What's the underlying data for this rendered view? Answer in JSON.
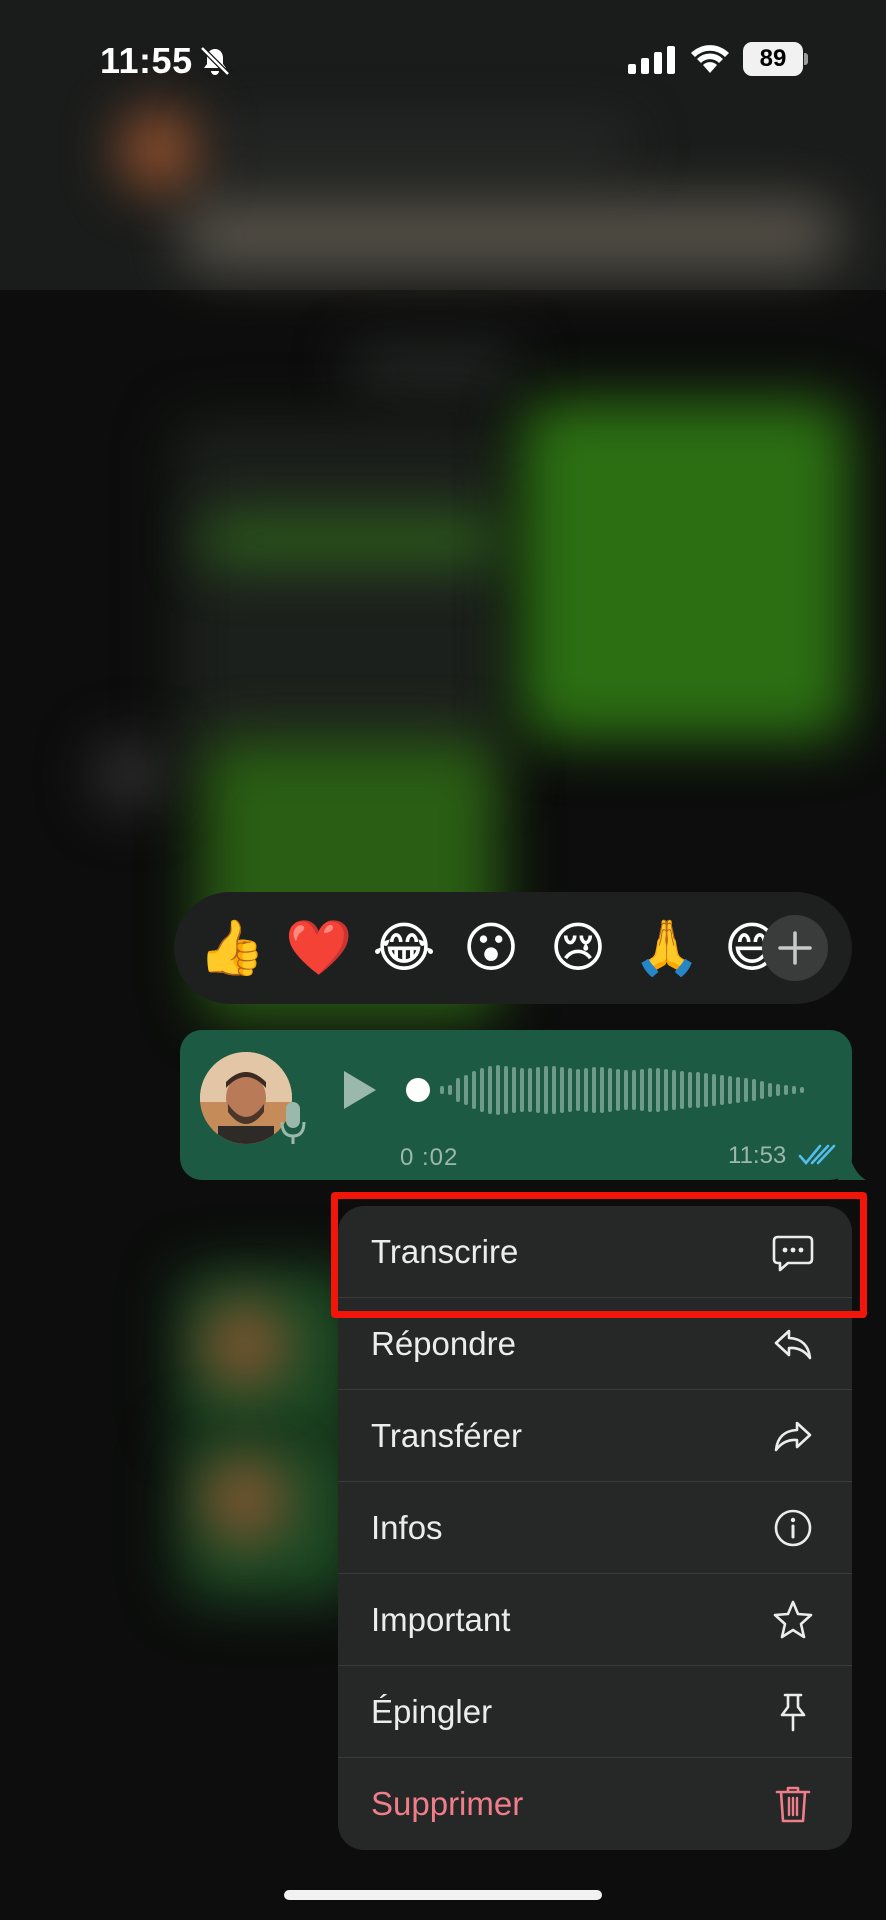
{
  "status_bar": {
    "time": "11:55",
    "battery_level": "89"
  },
  "reactions": {
    "emojis": [
      "👍",
      "❤️",
      "😂",
      "😮",
      "😢",
      "🙏",
      "😅"
    ]
  },
  "voice_message": {
    "duration": "0 :02",
    "time": "11:53",
    "colors": {
      "bubble": "#1c5a43",
      "ticks": "#53bdeb"
    }
  },
  "menu": {
    "items": [
      {
        "label": "Transcrire",
        "icon": "chat-bubble-icon"
      },
      {
        "label": "Répondre",
        "icon": "reply-icon"
      },
      {
        "label": "Transférer",
        "icon": "forward-icon"
      },
      {
        "label": "Infos",
        "icon": "info-icon"
      },
      {
        "label": "Important",
        "icon": "star-icon"
      },
      {
        "label": "Épingler",
        "icon": "pin-icon"
      },
      {
        "label": "Supprimer",
        "icon": "trash-icon",
        "destructive": true
      }
    ],
    "colors": {
      "destructive": "#f07d8a",
      "highlight": "#f2160a"
    }
  }
}
